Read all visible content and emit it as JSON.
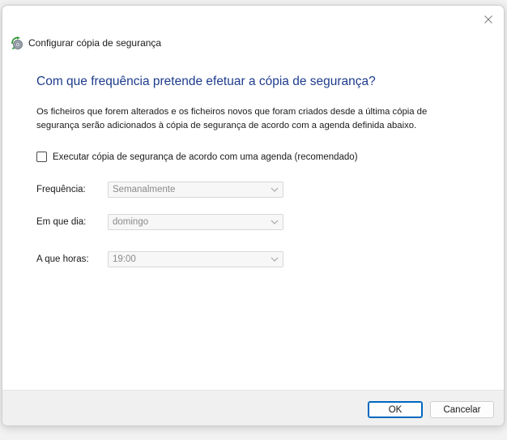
{
  "window": {
    "title": "Configurar cópia de segurança",
    "icon": "backup-icon"
  },
  "heading": "Com que frequência pretende efetuar a cópia de segurança?",
  "description": "Os ficheiros que forem alterados e os ficheiros novos que foram criados desde a última cópia de segurança serão adicionados à cópia de segurança de acordo com a agenda definida abaixo.",
  "schedule": {
    "checkbox_label": "Executar cópia de segurança de acordo com uma agenda (recomendado)",
    "checked": false
  },
  "fields": {
    "frequency": {
      "label": "Frequência:",
      "value": "Semanalmente",
      "enabled": false
    },
    "day": {
      "label": "Em que dia:",
      "value": "domingo",
      "enabled": false
    },
    "time": {
      "label": "A que horas:",
      "value": "19:00",
      "enabled": false
    }
  },
  "buttons": {
    "ok": "OK",
    "cancel": "Cancelar"
  },
  "colors": {
    "heading": "#1e3c8c",
    "accent": "#0067c0",
    "disabled_text": "#8a8a8a",
    "footer": "#f0f0f0"
  }
}
